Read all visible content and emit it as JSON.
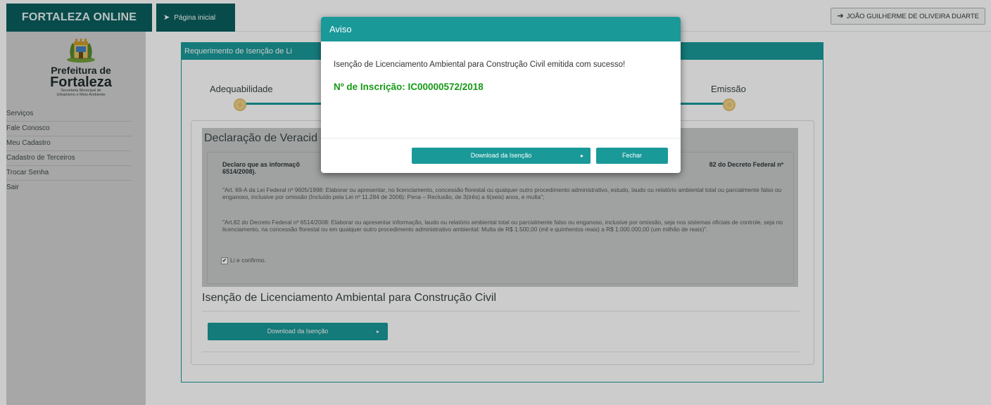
{
  "header": {
    "brand": "FORTALEZA ONLINE",
    "breadcrumb_icon": "arrow-icon",
    "breadcrumb": "Página inicial",
    "user_icon": "sign-in-arrow-icon",
    "user": "JOÃO GUILHERME DE OLIVEIRA DUARTE"
  },
  "sidebar": {
    "logo": {
      "line1": "Prefeitura de",
      "line2": "Fortaleza",
      "line3": "Secretaria Municipal de",
      "line4": "Urbanismo e Meio Ambiente"
    },
    "items": [
      {
        "label": "Serviços"
      },
      {
        "label": "Fale Conosco"
      },
      {
        "label": "Meu Cadastro"
      },
      {
        "label": "Cadastro de Terceiros"
      },
      {
        "label": "Trocar Senha"
      },
      {
        "label": "Sair"
      }
    ]
  },
  "main": {
    "panel_title": "Requerimento de Isenção de Li",
    "steps": {
      "first": "Adequabilidade",
      "last": "Emissão"
    },
    "declaration": {
      "title": "Declaração de Veracid",
      "bold_text": "Declaro que as informaçõ",
      "bold_text_right": "82 do Decreto Federal nº",
      "bold_text_line2": "6514/2008).",
      "para1": "\"Art. 69-A da Lei Federal nº 9605/1998: Elaborar ou apresentar, no licenciamento, concessão florestal ou qualquer outro procedimento administrativo, estudo, laudo ou relatório ambiental total ou parcialmente falso ou enganoso, inclusive por omissão (Incluído pela Lei nº 11.284 de 2006): Pena – Reclusão, de 3(três) a 6(seis) anos, e multa\";",
      "para2": "\"Art.82 do Decreto Federal nº 6514/2008: Elaborar ou apresentar informação, laudo ou relatório ambiental total ou parcialmente falso ou enganoso, inclusive por omissão, seja nos sistemas oficiais de controle, seja no licenciamento, na concessão florestal ou em qualquer outro procedimento administrativo ambiental: Multa de R$ 1.500,00 (mil e quinhentos reais) a R$ 1.000.000,00 (um milhão de reais)\".",
      "checkbox_label": "Li e confirmo.",
      "checked": true
    },
    "section_title": "Isenção de Licenciamento Ambiental para Construção Civil",
    "download_label": "Download da Isenção"
  },
  "modal": {
    "title": "Aviso",
    "message": "Isenção de Licenciamento Ambiental para Construção Civil emitida com sucesso!",
    "inscricao": "Nº de Inscrição: IC00000572/2018",
    "download_label": "Download da Isenção",
    "close_label": "Fechar"
  },
  "colors": {
    "teal": "#1a9999",
    "dark_teal": "#0b5e5e",
    "success_green": "#169a16"
  }
}
